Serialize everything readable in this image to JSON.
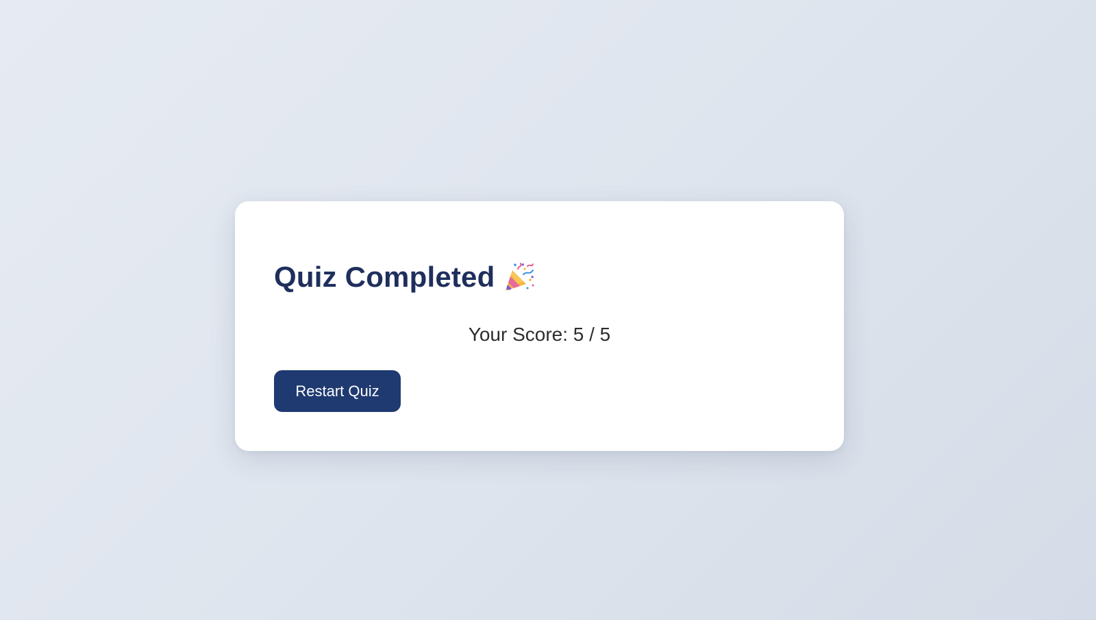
{
  "result": {
    "title": "Quiz Completed",
    "title_icon": "party-popper-icon",
    "score_text": "Your Score: 5 / 5",
    "score": 5,
    "total": 5,
    "restart_label": "Restart Quiz"
  },
  "colors": {
    "title": "#1f2f5c",
    "button_bg": "#1f3a70",
    "button_text": "#ffffff",
    "card_bg": "#ffffff",
    "score_text": "#2c2c2c"
  }
}
